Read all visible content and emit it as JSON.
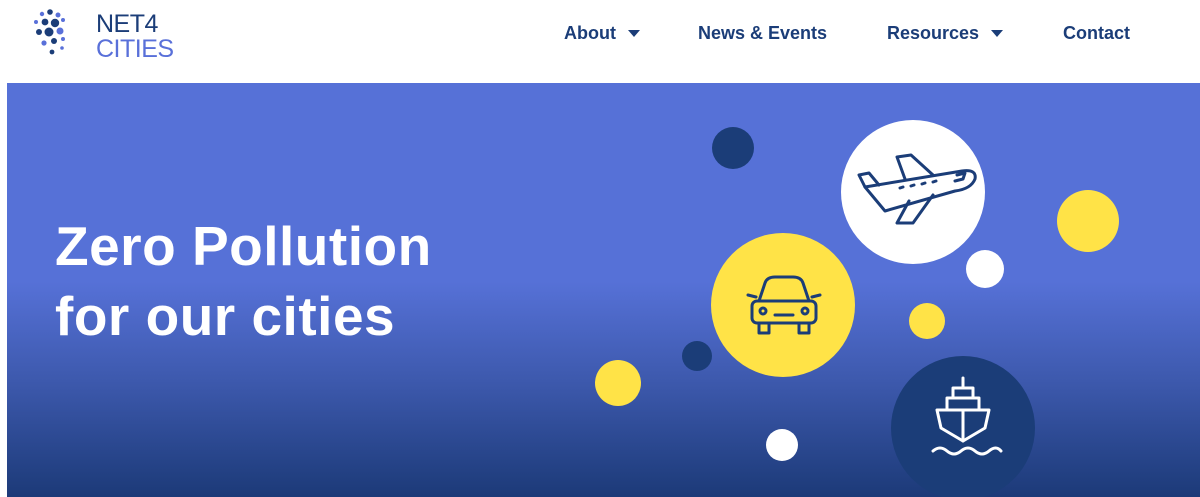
{
  "brand": {
    "line1": "NET4",
    "line2": "CITIES"
  },
  "nav": {
    "items": [
      {
        "label": "About",
        "has_dropdown": true
      },
      {
        "label": "News & Events",
        "has_dropdown": false
      },
      {
        "label": "Resources",
        "has_dropdown": true
      },
      {
        "label": "Contact",
        "has_dropdown": false
      }
    ]
  },
  "hero": {
    "title_line1": "Zero Pollution",
    "title_line2": "for our cities",
    "icons": [
      "airplane-icon",
      "car-icon",
      "ship-icon"
    ]
  },
  "colors": {
    "navy": "#1b3d78",
    "brand_blue": "#5970d9",
    "hero_blue": "#5671d7",
    "yellow": "#ffe347",
    "white": "#ffffff"
  }
}
